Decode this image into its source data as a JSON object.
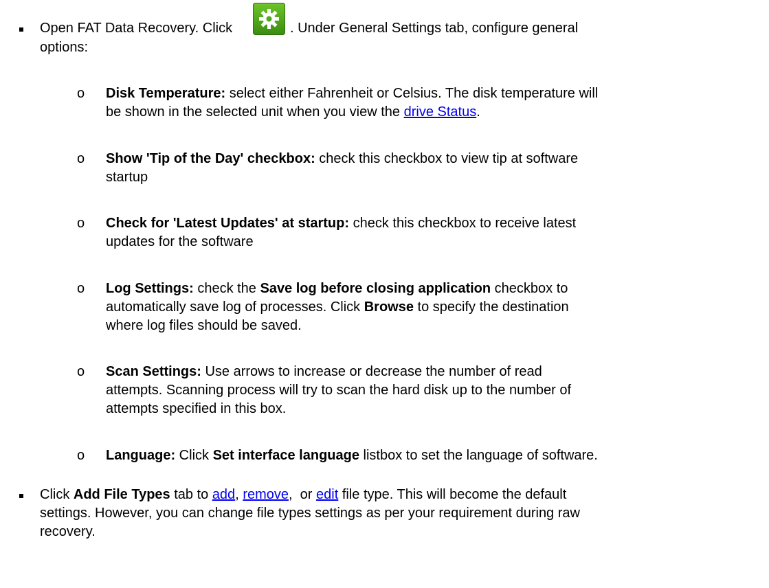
{
  "item1": {
    "text_before_icon": "Open FAT Data Recovery. Click",
    "icon": "gear-settings-icon",
    "text_after_icon": ". Under General Settings tab, configure general",
    "text_line2": "options:"
  },
  "options": [
    {
      "label": "Disk Temperature:",
      "text1": " select either Fahrenheit or Celsius. The disk temperature will",
      "text2_before_link": "be shown in the selected unit when you view the ",
      "link": "drive Status",
      "text2_after_link": "."
    },
    {
      "label": "Show 'Tip of the Day' checkbox:",
      "text1": " check this checkbox to view tip at software",
      "text2": "startup"
    },
    {
      "label": "Check for 'Latest Updates' at startup:",
      "text1": " check this checkbox to receive latest",
      "text2": "updates for the software"
    },
    {
      "label": "Log Settings:",
      "text1a": " check the ",
      "bold1": "Save log before closing application",
      "text1b": " checkbox to",
      "text2a": "automatically save log of processes. Click ",
      "bold2": "Browse",
      "text2b": " to specify the destination",
      "text3": "where log files should be saved."
    },
    {
      "label": "Scan Settings:",
      "text1": " Use arrows to increase or decrease the number of read",
      "text2": "attempts. Scanning process will try to scan the hard disk up to the number of",
      "text3": "attempts specified in this box."
    },
    {
      "label": "Language:",
      "text1a": " Click ",
      "bold1": "Set interface language",
      "text1b": " listbox to set the language of software."
    }
  ],
  "item2": {
    "text1a": "Click ",
    "bold1": "Add File Types",
    "text1b": " tab to ",
    "link_add": "add",
    "sep1": ", ",
    "link_remove": "remove",
    "sep2": ",  or ",
    "link_edit": "edit",
    "text1c": " file type. This will become the default",
    "text2": "settings. However, you can change file types settings as per your requirement during raw",
    "text3": "recovery."
  },
  "colors": {
    "link": "#0000ee",
    "icon_green": "#4fa81a"
  }
}
